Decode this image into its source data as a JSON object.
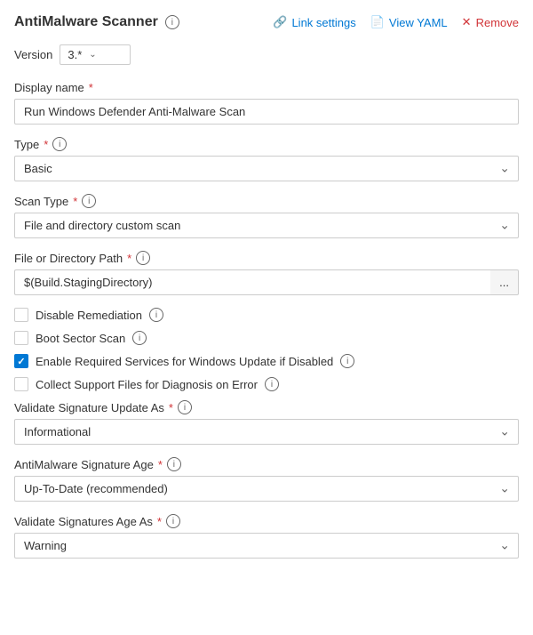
{
  "header": {
    "title": "AntiMalware Scanner",
    "link_settings_label": "Link settings",
    "view_yaml_label": "View YAML",
    "remove_label": "Remove"
  },
  "version": {
    "label": "Version",
    "value": "3.*"
  },
  "display_name": {
    "label": "Display name",
    "required": true,
    "value": "Run Windows Defender Anti-Malware Scan",
    "placeholder": "Display name"
  },
  "type_field": {
    "label": "Type",
    "required": true,
    "value": "Basic"
  },
  "scan_type": {
    "label": "Scan Type",
    "required": true,
    "value": "File and directory custom scan"
  },
  "file_path": {
    "label": "File or Directory Path",
    "required": true,
    "value": "$(Build.StagingDirectory)",
    "ellipsis": "..."
  },
  "checkboxes": {
    "disable_remediation": {
      "label": "Disable Remediation",
      "checked": false
    },
    "boot_sector_scan": {
      "label": "Boot Sector Scan",
      "checked": false
    },
    "enable_required_services": {
      "label": "Enable Required Services for Windows Update if Disabled",
      "checked": true
    },
    "collect_support_files": {
      "label": "Collect Support Files for Diagnosis on Error",
      "checked": false
    }
  },
  "validate_signature": {
    "label": "Validate Signature Update As",
    "required": true,
    "value": "Informational"
  },
  "signature_age": {
    "label": "AntiMalware Signature Age",
    "required": true,
    "value": "Up-To-Date (recommended)"
  },
  "validate_signatures_age": {
    "label": "Validate Signatures Age As",
    "required": true,
    "value": "Warning"
  }
}
